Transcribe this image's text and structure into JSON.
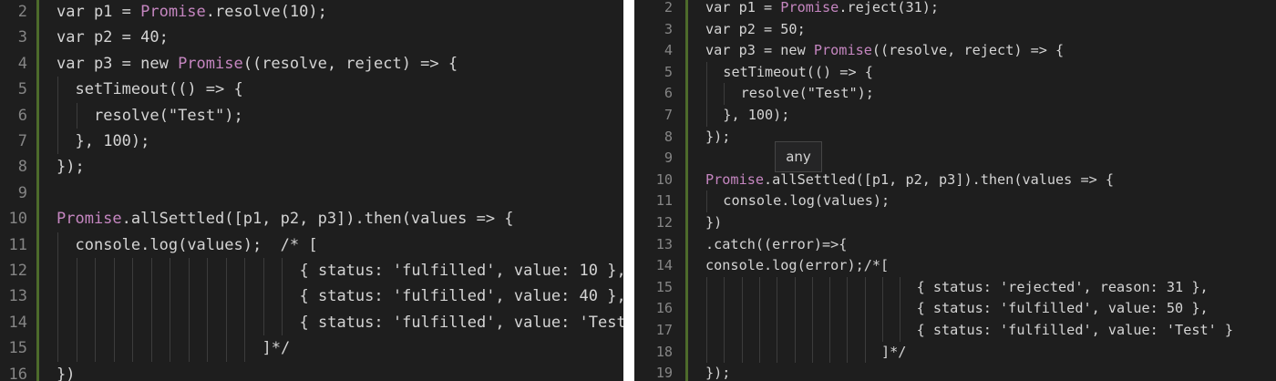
{
  "left_editor": {
    "lines": [
      {
        "n": "2",
        "text": "var p1 = Promise.resolve(10);",
        "indent": 0
      },
      {
        "n": "3",
        "text": "var p2 = 40;",
        "indent": 0
      },
      {
        "n": "4",
        "text": "var p3 = new Promise((resolve, reject) => {",
        "indent": 0
      },
      {
        "n": "5",
        "text": "setTimeout(() => {",
        "indent": 1
      },
      {
        "n": "6",
        "text": "resolve(\"Test\");",
        "indent": 2
      },
      {
        "n": "7",
        "text": "}, 100);",
        "indent": 1
      },
      {
        "n": "8",
        "text": "});",
        "indent": 0
      },
      {
        "n": "9",
        "text": "",
        "indent": 0
      },
      {
        "n": "10",
        "text": "Promise.allSettled([p1, p2, p3]).then(values => {",
        "indent": 0
      },
      {
        "n": "11",
        "text": "console.log(values);  /* [",
        "indent": 1
      },
      {
        "n": "12",
        "text": "{ status: 'fulfilled', value: 10 },",
        "indent": 13
      },
      {
        "n": "13",
        "text": "{ status: 'fulfilled', value: 40 },",
        "indent": 13
      },
      {
        "n": "14",
        "text": "{ status: 'fulfilled', value: 'Test' }",
        "indent": 13
      },
      {
        "n": "15",
        "text": "]*/",
        "indent": 11
      },
      {
        "n": "16",
        "text": "})",
        "indent": 0
      }
    ]
  },
  "right_editor": {
    "lines": [
      {
        "n": "2",
        "text": "var p1 = Promise.reject(31);",
        "indent": 0
      },
      {
        "n": "3",
        "text": "var p2 = 50;",
        "indent": 0
      },
      {
        "n": "4",
        "text": "var p3 = new Promise((resolve, reject) => {",
        "indent": 0
      },
      {
        "n": "5",
        "text": "setTimeout(() => {",
        "indent": 1
      },
      {
        "n": "6",
        "text": "resolve(\"Test\");",
        "indent": 2
      },
      {
        "n": "7",
        "text": "}, 100);",
        "indent": 1
      },
      {
        "n": "8",
        "text": "});",
        "indent": 0
      },
      {
        "n": "9",
        "text": "",
        "indent": 0
      },
      {
        "n": "10",
        "text": "Promise.allSettled([p1, p2, p3]).then(values => {",
        "indent": 0
      },
      {
        "n": "11",
        "text": "console.log(values);",
        "indent": 1
      },
      {
        "n": "12",
        "text": "})",
        "indent": 0
      },
      {
        "n": "13",
        "text": ".catch((error)=>{",
        "indent": 0
      },
      {
        "n": "14",
        "text": "console.log(error);/*[",
        "indent": 0
      },
      {
        "n": "15",
        "text": "{ status: 'rejected', reason: 31 },",
        "indent": 12
      },
      {
        "n": "16",
        "text": "{ status: 'fulfilled', value: 50 },",
        "indent": 12
      },
      {
        "n": "17",
        "text": "{ status: 'fulfilled', value: 'Test' }",
        "indent": 12
      },
      {
        "n": "18",
        "text": "]*/",
        "indent": 10
      },
      {
        "n": "19",
        "text": "});",
        "indent": 0
      }
    ],
    "hover_tooltip": "any"
  },
  "colors": {
    "background": "#1e1e1e",
    "line_number": "#858585",
    "text": "#d4d4d4",
    "promise_keyword": "#c586c0",
    "gutter_border": "#4d6b2b"
  }
}
